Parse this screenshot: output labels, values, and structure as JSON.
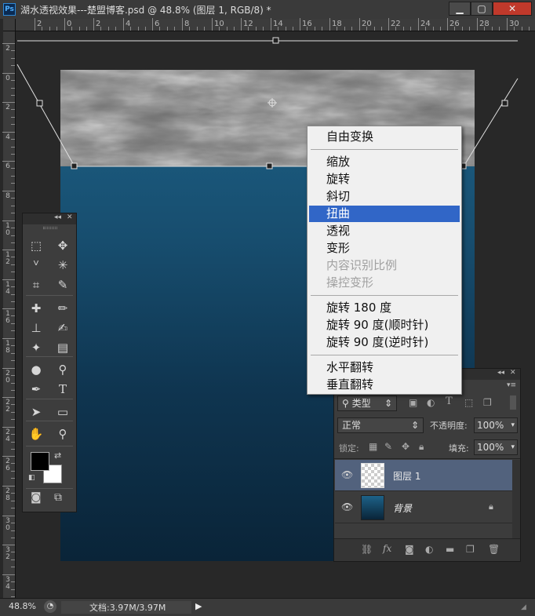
{
  "window": {
    "app_icon": "Ps",
    "title": "湖水透视效果---楚盟博客.psd @ 48.8% (图层 1, RGB/8) *",
    "minimize_icon": "minimize-icon",
    "maximize_icon": "maximize-icon",
    "close_icon": "close-icon"
  },
  "ruler": {
    "h_labels": [
      "2",
      "0",
      "2",
      "4",
      "6",
      "8",
      "10",
      "12",
      "14",
      "16",
      "18",
      "20",
      "22",
      "24",
      "26",
      "28",
      "30"
    ],
    "v_labels": [
      "2",
      "0",
      "2",
      "4",
      "6",
      "8",
      "10",
      "12",
      "14",
      "16",
      "18",
      "20",
      "22",
      "24",
      "26",
      "28",
      "30",
      "32",
      "34"
    ]
  },
  "context_menu": {
    "items": [
      {
        "label": "自由变换",
        "enabled": true
      },
      {
        "label": "缩放",
        "enabled": true
      },
      {
        "label": "旋转",
        "enabled": true
      },
      {
        "label": "斜切",
        "enabled": true
      },
      {
        "label": "扭曲",
        "enabled": true,
        "highlighted": true
      },
      {
        "label": "透视",
        "enabled": true
      },
      {
        "label": "变形",
        "enabled": true
      },
      {
        "label": "内容识别比例",
        "enabled": false
      },
      {
        "label": "操控变形",
        "enabled": false
      },
      {
        "label": "旋转 180 度",
        "enabled": true
      },
      {
        "label": "旋转 90 度(顺时针)",
        "enabled": true
      },
      {
        "label": "旋转 90 度(逆时针)",
        "enabled": true
      },
      {
        "label": "水平翻转",
        "enabled": true
      },
      {
        "label": "垂直翻转",
        "enabled": true
      }
    ],
    "highlight_color": "#3166c7"
  },
  "tools_panel": {
    "collapse_icon": "double-chevron-left-icon",
    "close_icon": "close-icon",
    "tools": [
      {
        "icon": "marquee-icon",
        "glyph": "⬚"
      },
      {
        "icon": "move-icon",
        "glyph": "✥"
      },
      {
        "icon": "lasso-icon",
        "glyph": "ⱽ"
      },
      {
        "icon": "magic-wand-icon",
        "glyph": "✳"
      },
      {
        "icon": "crop-icon",
        "glyph": "⌗"
      },
      {
        "icon": "eyedropper-icon",
        "glyph": "✎"
      },
      {
        "icon": "healing-brush-icon",
        "glyph": "✚"
      },
      {
        "icon": "brush-icon",
        "glyph": "✏"
      },
      {
        "icon": "clone-stamp-icon",
        "glyph": "⊥"
      },
      {
        "icon": "history-brush-icon",
        "glyph": "✍"
      },
      {
        "icon": "eraser-icon",
        "glyph": "✦"
      },
      {
        "icon": "gradient-icon",
        "glyph": "▤"
      },
      {
        "icon": "blur-icon",
        "glyph": "●"
      },
      {
        "icon": "dodge-icon",
        "glyph": "⚲"
      },
      {
        "icon": "pen-icon",
        "glyph": "✒"
      },
      {
        "icon": "type-icon",
        "glyph": "T"
      },
      {
        "icon": "path-selection-icon",
        "glyph": "➤"
      },
      {
        "icon": "shape-icon",
        "glyph": "▭"
      },
      {
        "icon": "hand-icon",
        "glyph": "✋"
      },
      {
        "icon": "zoom-icon",
        "glyph": "⚲"
      }
    ],
    "foreground_color": "#000000",
    "background_color": "#ffffff",
    "swap_icon": "swap-colors-icon",
    "default_colors_icon": "default-colors-icon",
    "quick_mask_icon": "quick-mask-icon",
    "screen_mode_icon": "screen-mode-icon"
  },
  "layers_panel": {
    "filter_label": "类型",
    "blend_mode": "正常",
    "opacity_label": "不透明度:",
    "opacity_value": "100%",
    "lock_label": "锁定:",
    "fill_label": "填充:",
    "fill_value": "100%",
    "layers": [
      {
        "name": "图层 1",
        "selected": true,
        "thumb": "transparent"
      },
      {
        "name": "背景",
        "selected": false,
        "thumb": "blue",
        "locked": true
      }
    ],
    "footer_icons": [
      "link-icon",
      "fx-icon",
      "mask-icon",
      "adjustment-icon",
      "folder-icon",
      "new-layer-icon",
      "trash-icon"
    ]
  },
  "status_bar": {
    "zoom": "48.8%",
    "doc_size": "文档:3.97M/3.97M"
  }
}
